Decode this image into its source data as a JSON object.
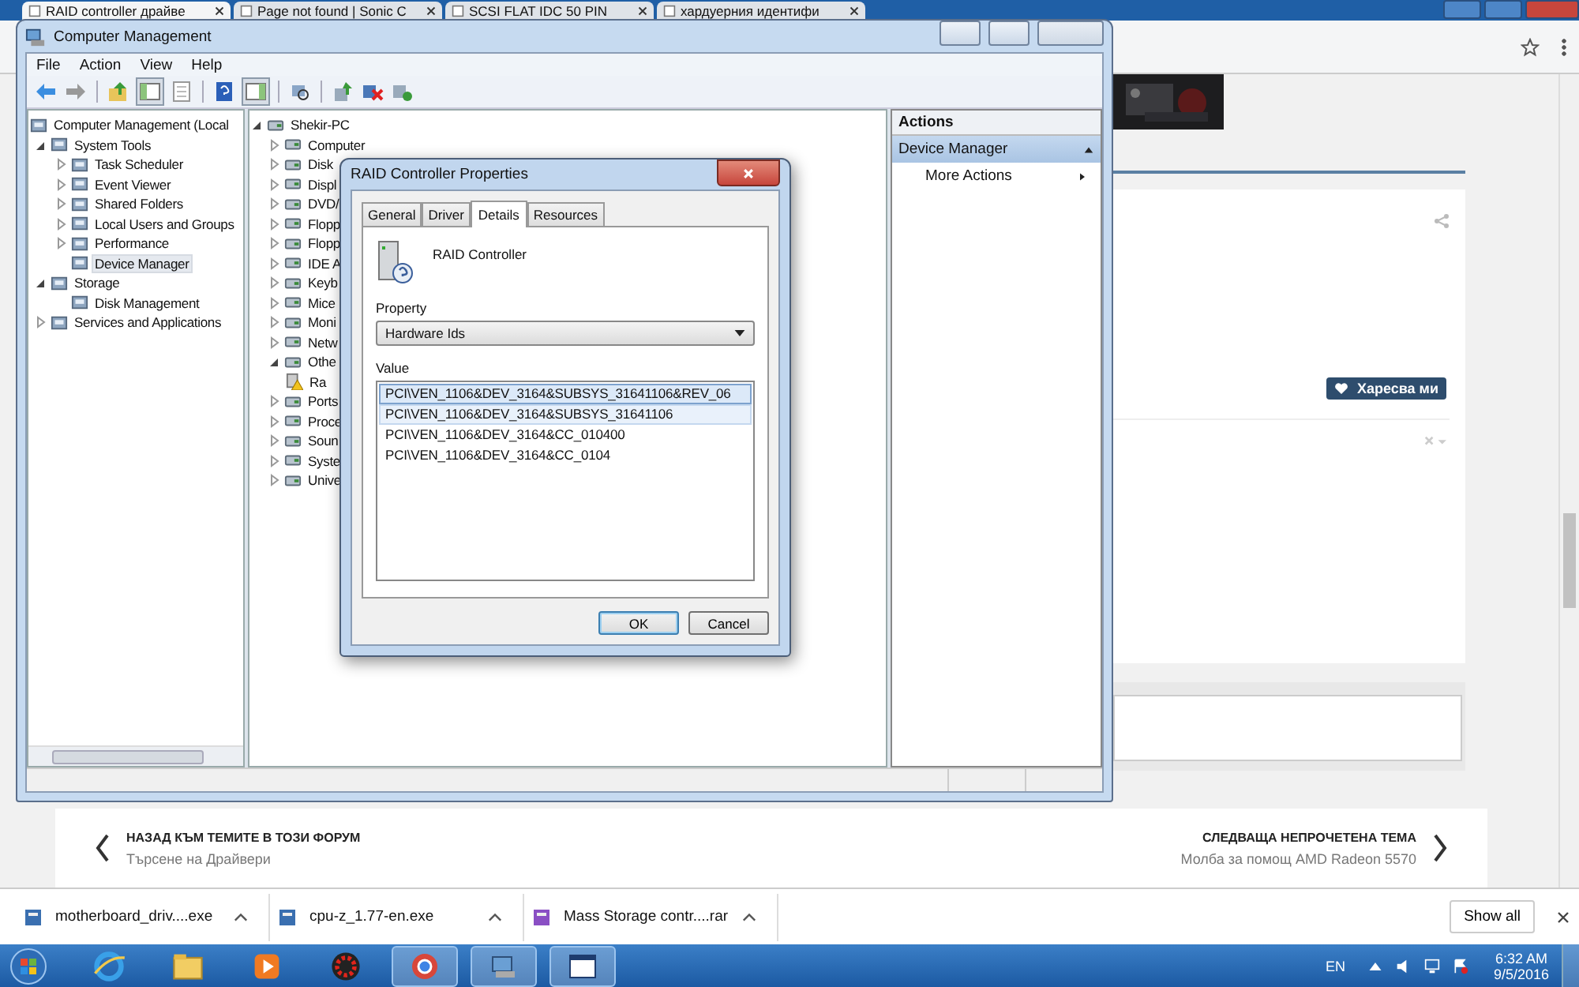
{
  "browser": {
    "tabs": [
      {
        "title": "RAID controller драйве",
        "selected": true
      },
      {
        "title": "Page not found | Sonic C",
        "selected": false
      },
      {
        "title": "SCSI FLAT IDC 50 PIN",
        "selected": false
      },
      {
        "title": "хардуерния идентифи",
        "selected": false
      }
    ]
  },
  "web": {
    "like_button": "Харесва ми",
    "nav_back": {
      "heading": "НАЗАД КЪМ ТЕМИТЕ В ТОЗИ ФОРУМ",
      "subtitle": "Търсене на Драйвери"
    },
    "nav_next": {
      "heading": "СЛЕДВАЩА НЕПРОЧЕТЕНА ТЕМА",
      "subtitle": "Молба за помощ AMD Radeon 5570"
    }
  },
  "window": {
    "title": "Computer Management",
    "menu": [
      "File",
      "Action",
      "View",
      "Help"
    ],
    "left_tree": [
      {
        "label": "Computer Management (Local",
        "selected": false,
        "children": [
          {
            "label": "System Tools",
            "kind": "group",
            "expanded": true,
            "selected": false,
            "children": [
              {
                "label": "Task Scheduler",
                "kind": "group",
                "expanded": false,
                "selected": false
              },
              {
                "label": "Event Viewer",
                "kind": "group",
                "expanded": false,
                "selected": false
              },
              {
                "label": "Shared Folders",
                "kind": "group",
                "expanded": false,
                "selected": false
              },
              {
                "label": "Local Users and Groups",
                "kind": "group",
                "expanded": false,
                "selected": false
              },
              {
                "label": "Performance",
                "kind": "group",
                "expanded": false,
                "selected": false
              },
              {
                "label": "Device Manager",
                "kind": "item",
                "selected": true
              }
            ]
          },
          {
            "label": "Storage",
            "kind": "group",
            "expanded": true,
            "selected": false,
            "children": [
              {
                "label": "Disk Management",
                "kind": "item",
                "selected": false
              }
            ]
          },
          {
            "label": "Services and Applications",
            "kind": "group",
            "expanded": false,
            "selected": false
          }
        ]
      }
    ],
    "device_tree": [
      {
        "label": "Shekir-PC",
        "kind": "group",
        "expanded": true,
        "children": [
          {
            "label": "Computer",
            "kind": "group",
            "expanded": false
          },
          {
            "label": "Disk",
            "kind": "group",
            "expanded": false
          },
          {
            "label": "Displ",
            "kind": "group",
            "expanded": false
          },
          {
            "label": "DVD/",
            "kind": "group",
            "expanded": false
          },
          {
            "label": "Flopp",
            "kind": "group",
            "expanded": false
          },
          {
            "label": "Flopp",
            "kind": "group",
            "expanded": false
          },
          {
            "label": "IDE A",
            "kind": "group",
            "expanded": false
          },
          {
            "label": "Keyb",
            "kind": "group",
            "expanded": false
          },
          {
            "label": "Mice",
            "kind": "group",
            "expanded": false
          },
          {
            "label": "Moni",
            "kind": "group",
            "expanded": false
          },
          {
            "label": "Netw",
            "kind": "group",
            "expanded": false
          },
          {
            "label": "Othe",
            "kind": "group",
            "expanded": true,
            "children": [
              {
                "label": "Ra",
                "kind": "item"
              }
            ]
          },
          {
            "label": "Ports",
            "kind": "group",
            "expanded": false
          },
          {
            "label": "Proce",
            "kind": "group",
            "expanded": false
          },
          {
            "label": "Soun",
            "kind": "group",
            "expanded": false
          },
          {
            "label": "Syste",
            "kind": "group",
            "expanded": false
          },
          {
            "label": "Unive",
            "kind": "group",
            "expanded": false
          }
        ]
      }
    ],
    "actions": {
      "header": "Actions",
      "section": "Device Manager",
      "items": [
        "More Actions"
      ]
    }
  },
  "dialog": {
    "title": "RAID Controller Properties",
    "tabs": [
      {
        "label": "General",
        "selected": false
      },
      {
        "label": "Driver",
        "selected": false
      },
      {
        "label": "Details",
        "selected": true
      },
      {
        "label": "Resources",
        "selected": false
      }
    ],
    "device_name": "RAID Controller",
    "property_label": "Property",
    "property_value": "Hardware Ids",
    "value_label": "Value",
    "values": [
      {
        "text": "PCI\\VEN_1106&DEV_3164&SUBSYS_31641106&REV_06",
        "selected": true
      },
      {
        "text": "PCI\\VEN_1106&DEV_3164&SUBSYS_31641106",
        "selected": true
      },
      {
        "text": "PCI\\VEN_1106&DEV_3164&CC_010400",
        "selected": false
      },
      {
        "text": "PCI\\VEN_1106&DEV_3164&CC_0104",
        "selected": false
      }
    ],
    "buttons": [
      "OK",
      "Cancel"
    ]
  },
  "downloads": {
    "items": [
      "motherboard_driv....exe",
      "cpu-z_1.77-en.exe",
      "Mass Storage contr....rar"
    ],
    "show_all": "Show all"
  },
  "taskbar": {
    "language": "EN",
    "time": "6:32 AM",
    "date": "9/5/2016"
  }
}
